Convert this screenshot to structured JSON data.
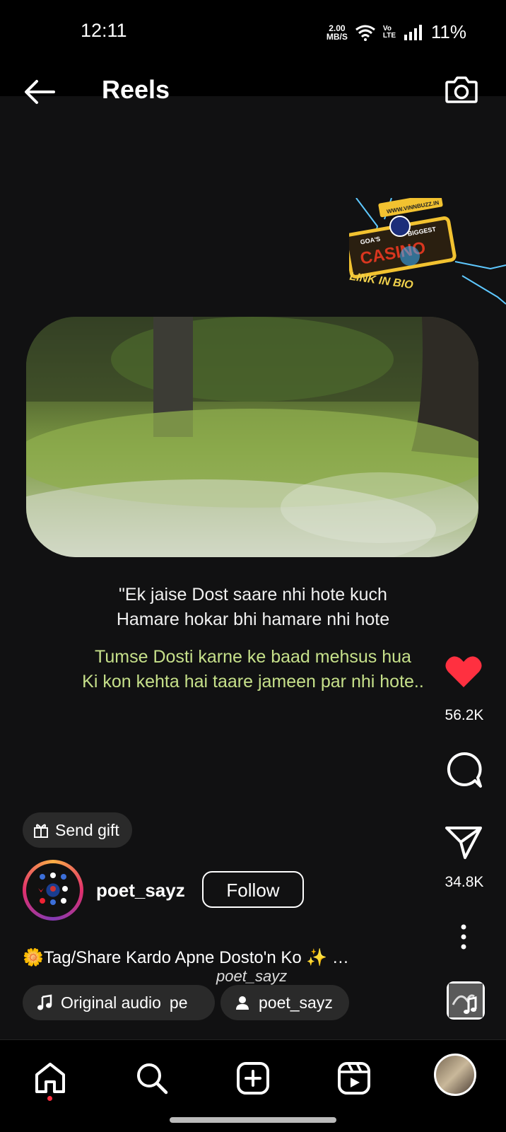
{
  "status_bar": {
    "time": "12:11",
    "net_speed_value": "2.00",
    "net_speed_unit": "MB/S",
    "volte": "Vo LTE",
    "battery": "11%"
  },
  "header": {
    "title": "Reels"
  },
  "ad_sticker": {
    "site": "WWW.VINNBUZZ.IN",
    "tagline_left": "GOA'S",
    "tagline_right": "BIGGEST",
    "word": "CASINO",
    "link_text": "LINK IN BIO"
  },
  "poem": {
    "line1": "\"Ek jaise Dost saare nhi hote kuch",
    "line2": "Hamare hokar bhi hamare nhi hote",
    "line3": "Tumse Dosti karne ke baad mehsus hua",
    "line4": "Ki kon kehta hai taare jameen par nhi hote.."
  },
  "actions": {
    "likes": "56.2K",
    "shares": "34.8K"
  },
  "gift": {
    "label": "Send gift"
  },
  "profile": {
    "username": "poet_sayz",
    "follow_label": "Follow"
  },
  "caption": {
    "text": "🌼Tag/Share Kardo Apne Dosto'n Ko ✨ …",
    "watermark": "poet_sayz"
  },
  "audio": {
    "label": "Original audio",
    "trailing": "pe",
    "user": "poet_sayz"
  },
  "colors": {
    "like": "#ff3040",
    "poem_green": "#c6e08a",
    "chip_bg": "#2a2a2a"
  }
}
